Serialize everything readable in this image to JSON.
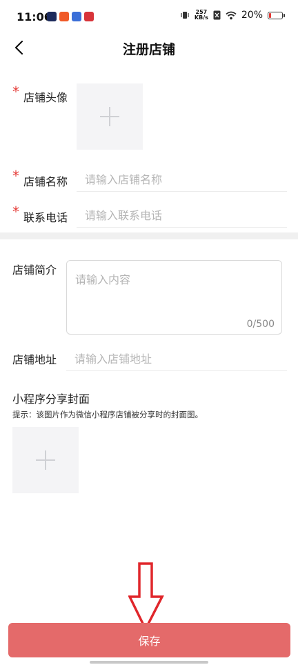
{
  "status_bar": {
    "time": "11:06",
    "net_speed_value": "257",
    "net_speed_unit": "KB/s",
    "battery_percent": "20%",
    "battery_level": 0.2
  },
  "nav": {
    "title": "注册店铺"
  },
  "form": {
    "required_mark": "*",
    "shop_avatar_label": "店铺头像",
    "shop_name_label": "店铺名称",
    "shop_name_placeholder": "请输入店铺名称",
    "phone_label": "联系电话",
    "phone_placeholder": "请输入联系电话",
    "intro_label": "店铺简介",
    "intro_placeholder": "请输入内容",
    "intro_counter": "0/500",
    "address_label": "店铺地址",
    "address_placeholder": "请输入店铺地址",
    "cover_label": "小程序分享封面",
    "cover_hint": "提示：该图片作为微信小程序店铺被分享时的封面图。"
  },
  "actions": {
    "save_label": "保存"
  },
  "colors": {
    "accent": "#e46a6a",
    "required": "#e53935",
    "annotation": "#e0262b"
  }
}
